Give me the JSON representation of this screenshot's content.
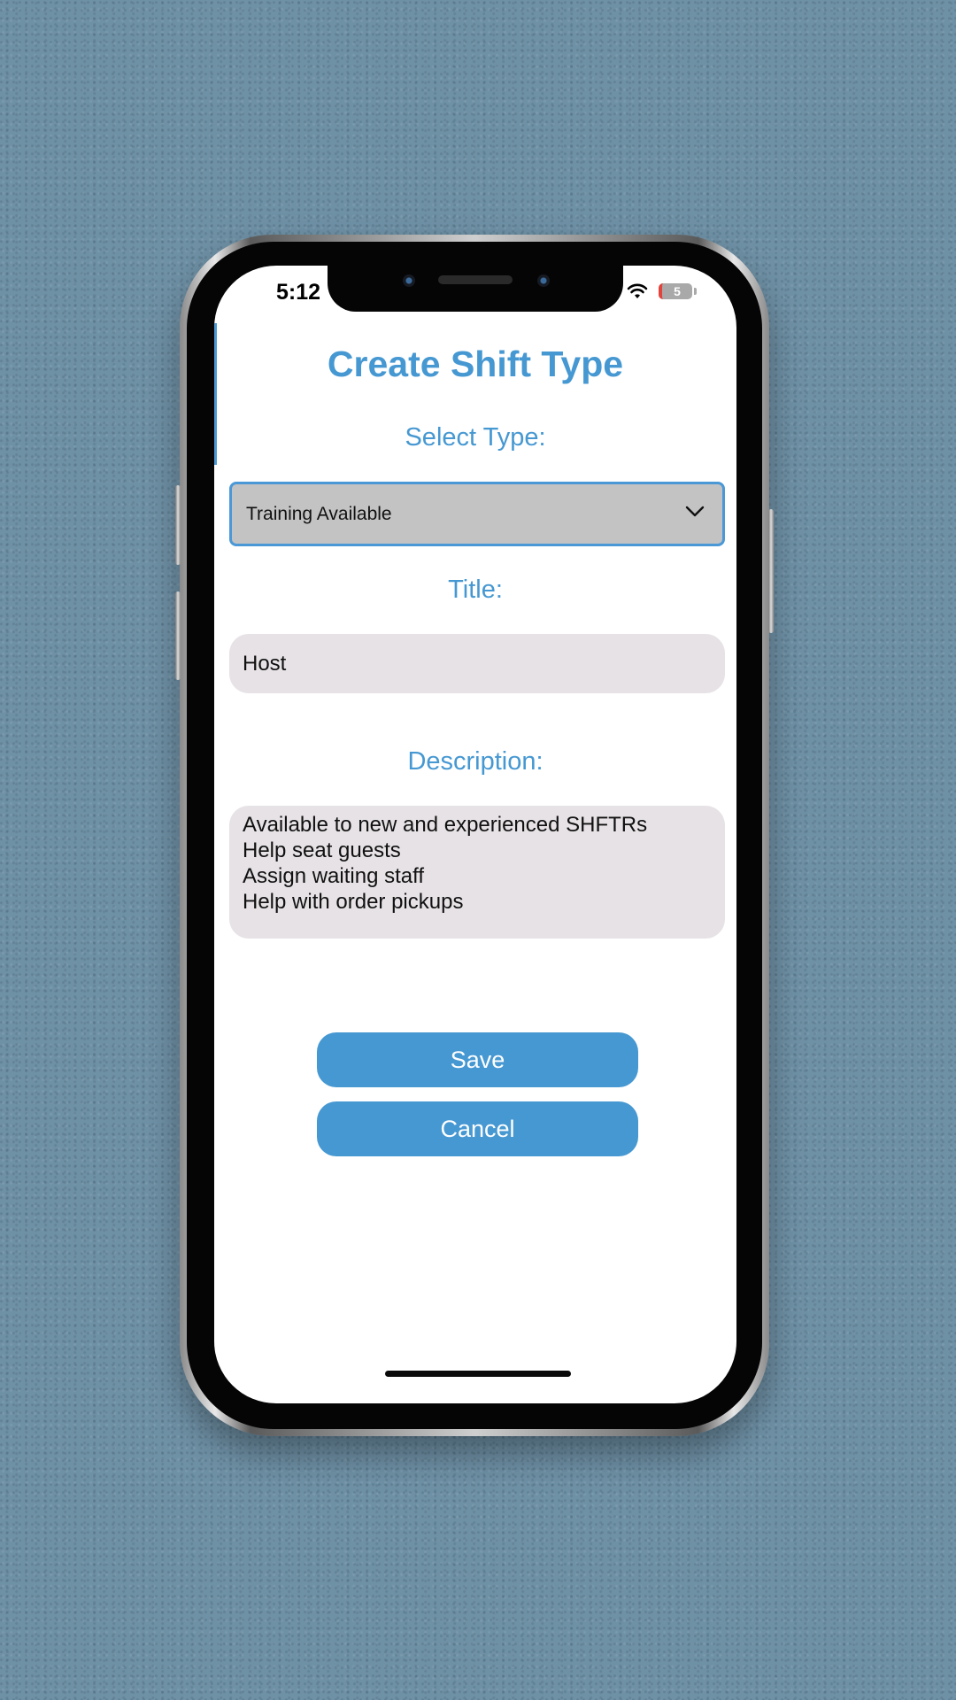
{
  "status_bar": {
    "time": "5:12",
    "battery_level": "5",
    "battery_color": "#a9a9a9",
    "battery_low_color": "#e2433a"
  },
  "form": {
    "title": "Create Shift Type",
    "select_type_label": "Select Type:",
    "select_type_value": "Training Available",
    "title_label": "Title:",
    "title_value": "Host",
    "description_label": "Description:",
    "description_value": "Available to new and experienced SHFTRs\nHelp seat guests\nAssign waiting staff\nHelp with order pickups"
  },
  "actions": {
    "save_label": "Save",
    "cancel_label": "Cancel"
  },
  "theme": {
    "accent": "#4698d2",
    "field_background": "#e6e2e5",
    "select_background": "#c3c3c3",
    "page_background": "#6f91a6"
  },
  "icons": {
    "dropdown": "chevron-down-icon",
    "wifi": "wifi-icon",
    "battery": "battery-icon"
  }
}
